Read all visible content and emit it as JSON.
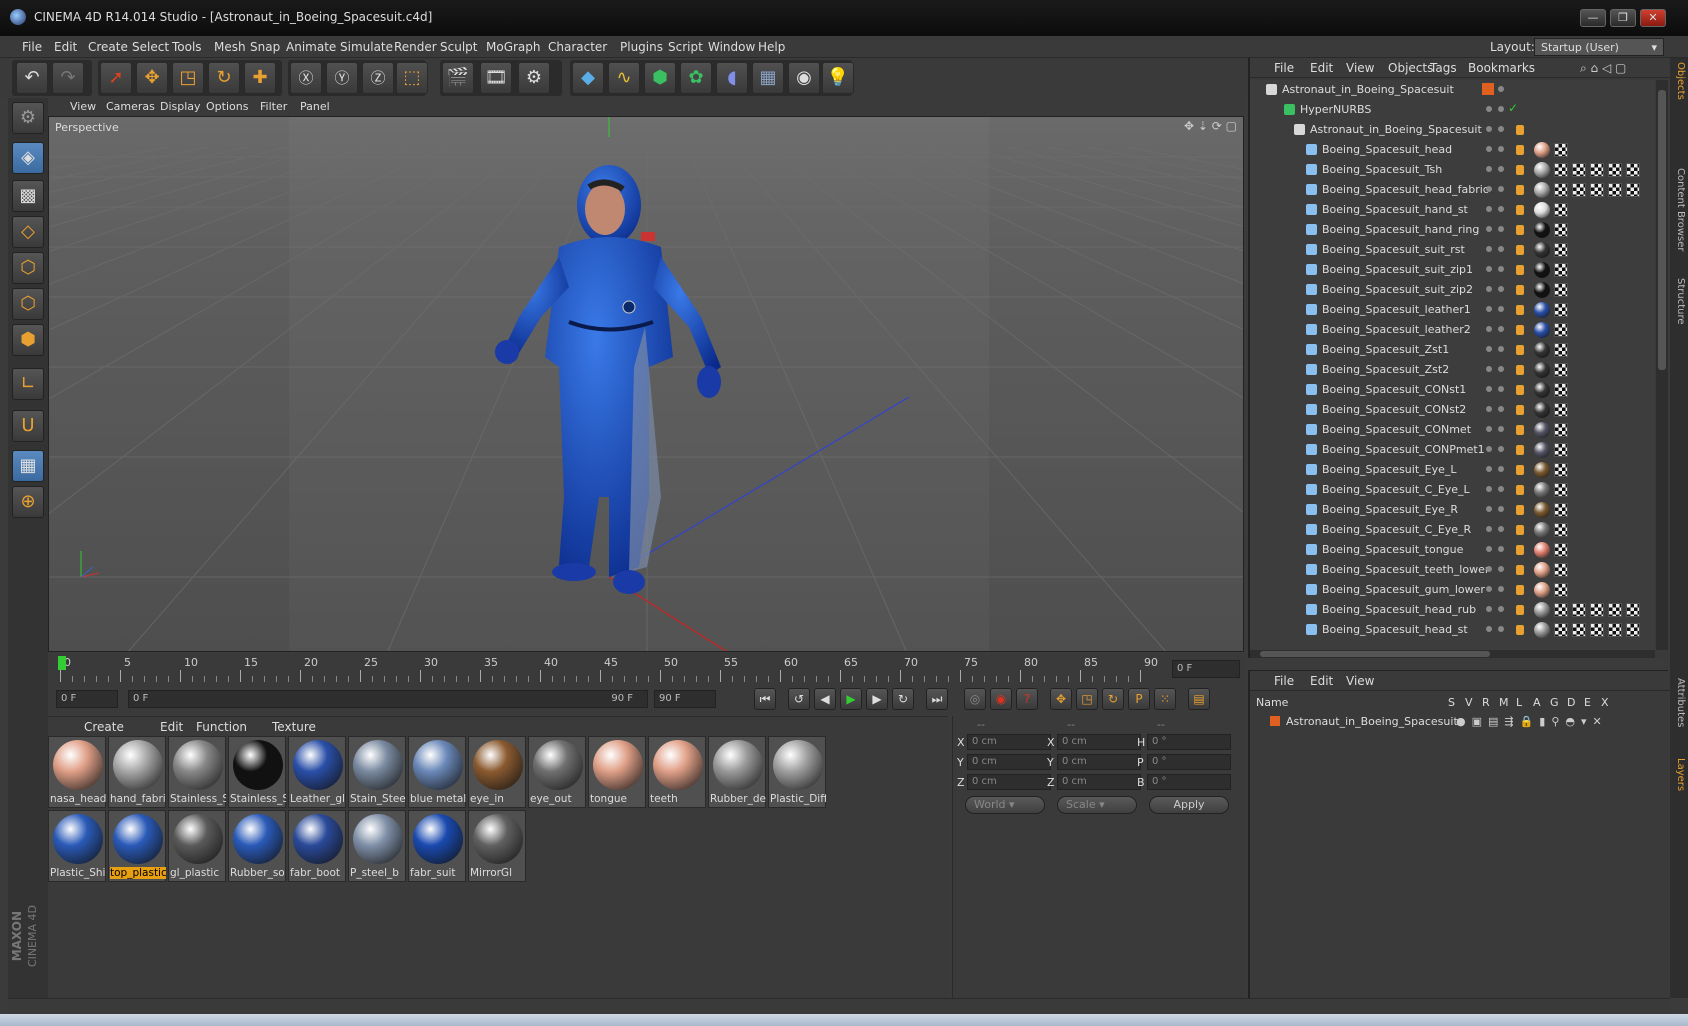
{
  "window": {
    "title": "CINEMA 4D R14.014 Studio - [Astronaut_in_Boeing_Spacesuit.c4d]",
    "min": "—",
    "max": "❐",
    "close": "✕"
  },
  "menu": [
    "File",
    "Edit",
    "Create",
    "Select",
    "Tools",
    "Mesh",
    "Snap",
    "Animate",
    "Simulate",
    "Render",
    "Sculpt",
    "MoGraph",
    "Character",
    "Plugins",
    "Script",
    "Window",
    "Help"
  ],
  "layout": {
    "label": "Layout:",
    "value": "Startup (User)"
  },
  "viewport": {
    "menu": [
      "View",
      "Cameras",
      "Display",
      "Options",
      "Filter",
      "Panel"
    ],
    "label": "Perspective"
  },
  "timeline": {
    "ticks": [
      "0",
      "5",
      "10",
      "15",
      "20",
      "25",
      "30",
      "35",
      "40",
      "45",
      "50",
      "55",
      "60",
      "65",
      "70",
      "75",
      "80",
      "85",
      "90"
    ],
    "current": "0 F"
  },
  "transport": {
    "start": "0 F",
    "slider_start": "0 F",
    "slider_end": "90 F",
    "end": "90 F"
  },
  "materials": {
    "menu": [
      "Create",
      "Edit",
      "Function",
      "Texture"
    ],
    "items": [
      {
        "name": "nasa_head",
        "c": "#e0a088"
      },
      {
        "name": "hand_fabri",
        "c": "#a8a8a8"
      },
      {
        "name": "Stainless_S",
        "c": "#888"
      },
      {
        "name": "Stainless_S",
        "c": "#111"
      },
      {
        "name": "Leather_gl",
        "c": "#2a4fa8"
      },
      {
        "name": "Stain_Steel",
        "c": "#7a8aa0"
      },
      {
        "name": "blue metal",
        "c": "#6a88b8"
      },
      {
        "name": "eye_in",
        "c": "#8a5a30"
      },
      {
        "name": "eye_out",
        "c": "#707070"
      },
      {
        "name": "tongue",
        "c": "#e0a088"
      },
      {
        "name": "teeth",
        "c": "#e0a088"
      },
      {
        "name": "Rubber_de",
        "c": "#9a9a9a"
      },
      {
        "name": "Plastic_Diff",
        "c": "#a0a0a0"
      },
      {
        "name": "Plastic_Shir",
        "c": "#2a5ab8"
      },
      {
        "name": "top_plastic",
        "c": "#2a5ab8"
      },
      {
        "name": "gl_plastic",
        "c": "#5a5a5a"
      },
      {
        "name": "Rubber_so",
        "c": "#2a5ab8"
      },
      {
        "name": "fabr_boot",
        "c": "#2a4a9a"
      },
      {
        "name": "P_steel_b",
        "c": "#8090a8"
      },
      {
        "name": "fabr_suit",
        "c": "#1a4ab0"
      },
      {
        "name": "MirrorGl",
        "c": "#606060"
      }
    ],
    "selected": "top_plastic"
  },
  "coords": {
    "header": [
      "--",
      "--",
      "--"
    ],
    "rows": [
      [
        "X",
        "0 cm",
        "X",
        "0 cm",
        "H",
        "0 °"
      ],
      [
        "Y",
        "0 cm",
        "Y",
        "0 cm",
        "P",
        "0 °"
      ],
      [
        "Z",
        "0 cm",
        "Z",
        "0 cm",
        "B",
        "0 °"
      ]
    ],
    "world": "World",
    "scale": "Scale",
    "apply": "Apply"
  },
  "objects": {
    "menu": [
      "File",
      "Edit",
      "View",
      "Objects",
      "Tags",
      "Bookmarks"
    ],
    "root": "Astronaut_in_Boeing_Spacesuit",
    "nurbs": "HyperNURBS",
    "group": "Astronaut_in_Boeing_Spacesuit",
    "items": [
      "Boeing_Spacesuit_head",
      "Boeing_Spacesuit_Tsh",
      "Boeing_Spacesuit_head_fabric",
      "Boeing_Spacesuit_hand_st",
      "Boeing_Spacesuit_hand_ring",
      "Boeing_Spacesuit_suit_rst",
      "Boeing_Spacesuit_suit_zip1",
      "Boeing_Spacesuit_suit_zip2",
      "Boeing_Spacesuit_leather1",
      "Boeing_Spacesuit_leather2",
      "Boeing_Spacesuit_Zst1",
      "Boeing_Spacesuit_Zst2",
      "Boeing_Spacesuit_CONst1",
      "Boeing_Spacesuit_CONst2",
      "Boeing_Spacesuit_CONmet",
      "Boeing_Spacesuit_CONPmet1",
      "Boeing_Spacesuit_Eye_L",
      "Boeing_Spacesuit_C_Eye_L",
      "Boeing_Spacesuit_Eye_R",
      "Boeing_Spacesuit_C_Eye_R",
      "Boeing_Spacesuit_tongue",
      "Boeing_Spacesuit_teeth_lower",
      "Boeing_Spacesuit_gum_lower",
      "Boeing_Spacesuit_head_rub",
      "Boeing_Spacesuit_head_st"
    ],
    "tagcolors": [
      "#e0a088",
      "#aaa",
      "#aaa",
      "#ddd",
      "#111",
      "#333",
      "#111",
      "#111",
      "#2a4fa8",
      "#2a4fa8",
      "#333",
      "#333",
      "#333",
      "#333",
      "#556",
      "#556",
      "#7a5a30",
      "#777",
      "#7a5a30",
      "#777",
      "#e08070",
      "#e0a088",
      "#e0a088",
      "#999",
      "#999"
    ]
  },
  "layers": {
    "menu": [
      "File",
      "Edit",
      "View"
    ],
    "cols": [
      "Name",
      "S",
      "V",
      "R",
      "M",
      "L",
      "A",
      "G",
      "D",
      "E",
      "X"
    ],
    "row": "Astronaut_in_Boeing_Spacesuit"
  },
  "sidetabs": [
    "Objects",
    "Content Browser",
    "Structure",
    "Attributes",
    "Layers"
  ],
  "brand": {
    "maxon": "MAXON",
    "c4d": "CINEMA 4D"
  }
}
